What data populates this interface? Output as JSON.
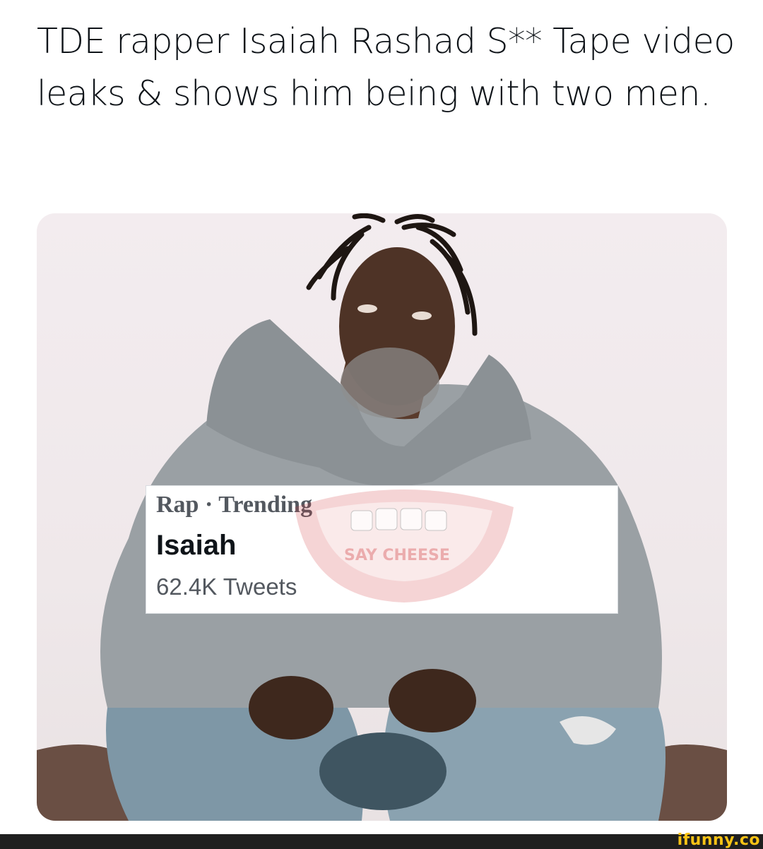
{
  "post": {
    "caption": "TDE rapper Isaiah Rashad S** Tape video leaks & shows him being with two men."
  },
  "trending_card": {
    "category_line": "Rap · Trending",
    "topic": "Isaiah",
    "tweet_count": "62.4K Tweets"
  },
  "watermark": {
    "text": "SAY CHEESE",
    "icon": "lips-mouth-icon"
  },
  "footer": {
    "logo": "ifunny.co",
    "logo_color": "#f9c315"
  },
  "colors": {
    "text_primary": "#0f1419",
    "text_secondary": "#53585f",
    "hoodie_gray": "#9aa0a4",
    "footer_bg": "#1f1f1f"
  }
}
